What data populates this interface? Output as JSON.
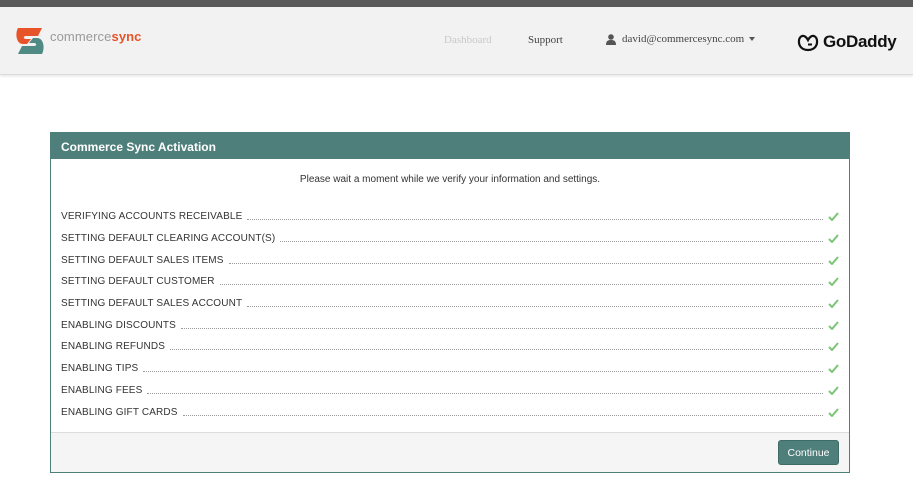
{
  "brand": {
    "name_light": "commerce",
    "name_bold": "sync",
    "logo_icon": "commercesync-logo"
  },
  "nav": {
    "dashboard_label": "Dashboard",
    "support_label": "Support",
    "user_email": "david@commercesync.com",
    "user_icon": "user-icon",
    "partner_name": "GoDaddy"
  },
  "panel": {
    "title": "Commerce Sync Activation",
    "intro": "Please wait a moment while we verify your information and settings.",
    "steps": [
      {
        "label": "VERIFYING ACCOUNTS RECEIVABLE",
        "status": "done"
      },
      {
        "label": "SETTING DEFAULT CLEARING ACCOUNT(S)",
        "status": "done"
      },
      {
        "label": "SETTING DEFAULT SALES ITEMS",
        "status": "done"
      },
      {
        "label": "SETTING DEFAULT CUSTOMER",
        "status": "done"
      },
      {
        "label": "SETTING DEFAULT SALES ACCOUNT",
        "status": "done"
      },
      {
        "label": "ENABLING DISCOUNTS",
        "status": "done"
      },
      {
        "label": "ENABLING REFUNDS",
        "status": "done"
      },
      {
        "label": "ENABLING TIPS",
        "status": "done"
      },
      {
        "label": "ENABLING FEES",
        "status": "done"
      },
      {
        "label": "ENABLING GIFT CARDS",
        "status": "done"
      }
    ],
    "continue_label": "Continue"
  },
  "colors": {
    "header_bg": "#f2f2f2",
    "top_strip": "#5a5a5a",
    "panel_accent": "#4f7f7b",
    "brand_orange": "#e8542a",
    "brand_teal": "#4f8a85",
    "check_green": "#7cc576"
  }
}
